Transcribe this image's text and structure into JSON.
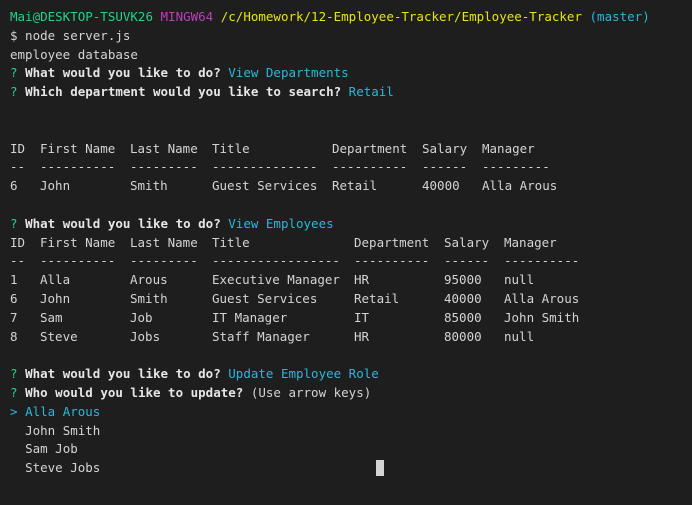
{
  "prompt": {
    "user_host": "Mai@DESKTOP-TSUVK26",
    "shell": "MINGW64",
    "path": "/c/Homework/12-Employee-Tracker/Employee-Tracker",
    "branch": "(master)"
  },
  "command": "$ node server.js",
  "banner": "employee database",
  "q1": {
    "mark": "?",
    "text": "What would you like to do?",
    "answer": "View Departments"
  },
  "q2": {
    "mark": "?",
    "text": "Which department would you like to search?",
    "answer": "Retail"
  },
  "table1": {
    "headers": [
      "ID",
      "First Name",
      "Last Name",
      "Title",
      "Department",
      "Salary",
      "Manager"
    ],
    "dashes": [
      "--",
      "----------",
      "---------",
      "--------------",
      "----------",
      "------",
      "---------"
    ],
    "rows": [
      [
        "6",
        "John",
        "Smith",
        "Guest Services",
        "Retail",
        "40000",
        "Alla Arous"
      ]
    ]
  },
  "q3": {
    "mark": "?",
    "text": "What would you like to do?",
    "answer": "View Employees"
  },
  "table2": {
    "headers": [
      "ID",
      "First Name",
      "Last Name",
      "Title",
      "Department",
      "Salary",
      "Manager"
    ],
    "dashes": [
      "--",
      "----------",
      "---------",
      "-----------------",
      "----------",
      "------",
      "----------"
    ],
    "rows": [
      [
        "1",
        "Alla",
        "Arous",
        "Executive Manager",
        "HR",
        "95000",
        "null"
      ],
      [
        "6",
        "John",
        "Smith",
        "Guest Services",
        "Retail",
        "40000",
        "Alla Arous"
      ],
      [
        "7",
        "Sam",
        "Job",
        "IT Manager",
        "IT",
        "85000",
        "John Smith"
      ],
      [
        "8",
        "Steve",
        "Jobs",
        "Staff Manager",
        "HR",
        "80000",
        "null"
      ]
    ]
  },
  "q4": {
    "mark": "?",
    "text": "What would you like to do?",
    "answer": "Update Employee Role"
  },
  "q5": {
    "mark": "?",
    "text": "Who would you like to update?",
    "hint": "(Use arrow keys)"
  },
  "choices": {
    "pointer": ">",
    "items": [
      "Alla Arous",
      "John Smith",
      "Sam Job",
      "Steve Jobs"
    ],
    "selected_index": 0
  }
}
